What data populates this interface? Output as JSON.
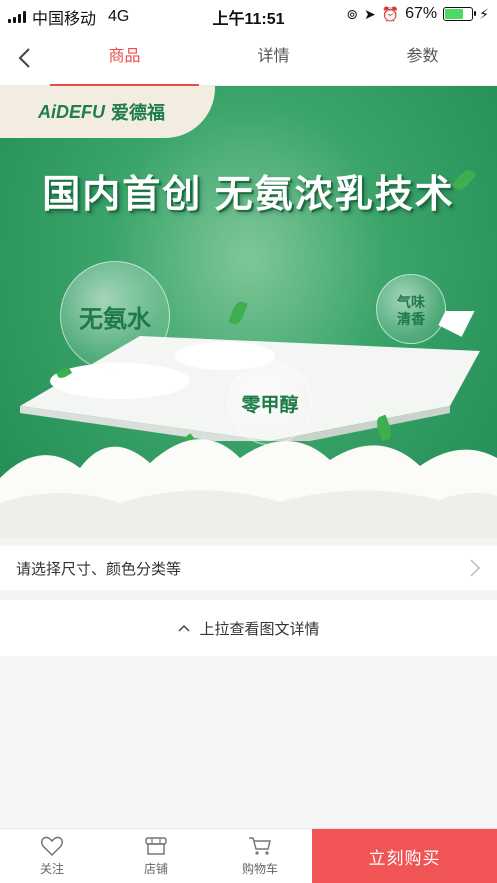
{
  "status_bar": {
    "carrier": "中国移动",
    "network": "4G",
    "time": "上午11:51",
    "battery": "67%",
    "battery_level": 0.67
  },
  "nav": {
    "tabs": [
      {
        "label": "商品",
        "active": true
      },
      {
        "label": "详情",
        "active": false
      },
      {
        "label": "参数",
        "active": false
      }
    ]
  },
  "banner": {
    "logo_brand": "AiDEFU",
    "logo_cn": "爱德福",
    "headline": "国内首创 无氨浓乳技术",
    "bubbles": [
      "无氨水",
      "零甲醇",
      "气味\n清香"
    ]
  },
  "options": {
    "label": "请选择尺寸、颜色分类等"
  },
  "pull": {
    "label": "上拉查看图文详情"
  },
  "bottom_bar": {
    "follow": "关注",
    "store": "店铺",
    "cart": "购物车",
    "buy": "立刻购买"
  },
  "colors": {
    "accent": "#e94b4b",
    "buy_button": "#f05454",
    "banner_green": "#2f9a5e"
  }
}
